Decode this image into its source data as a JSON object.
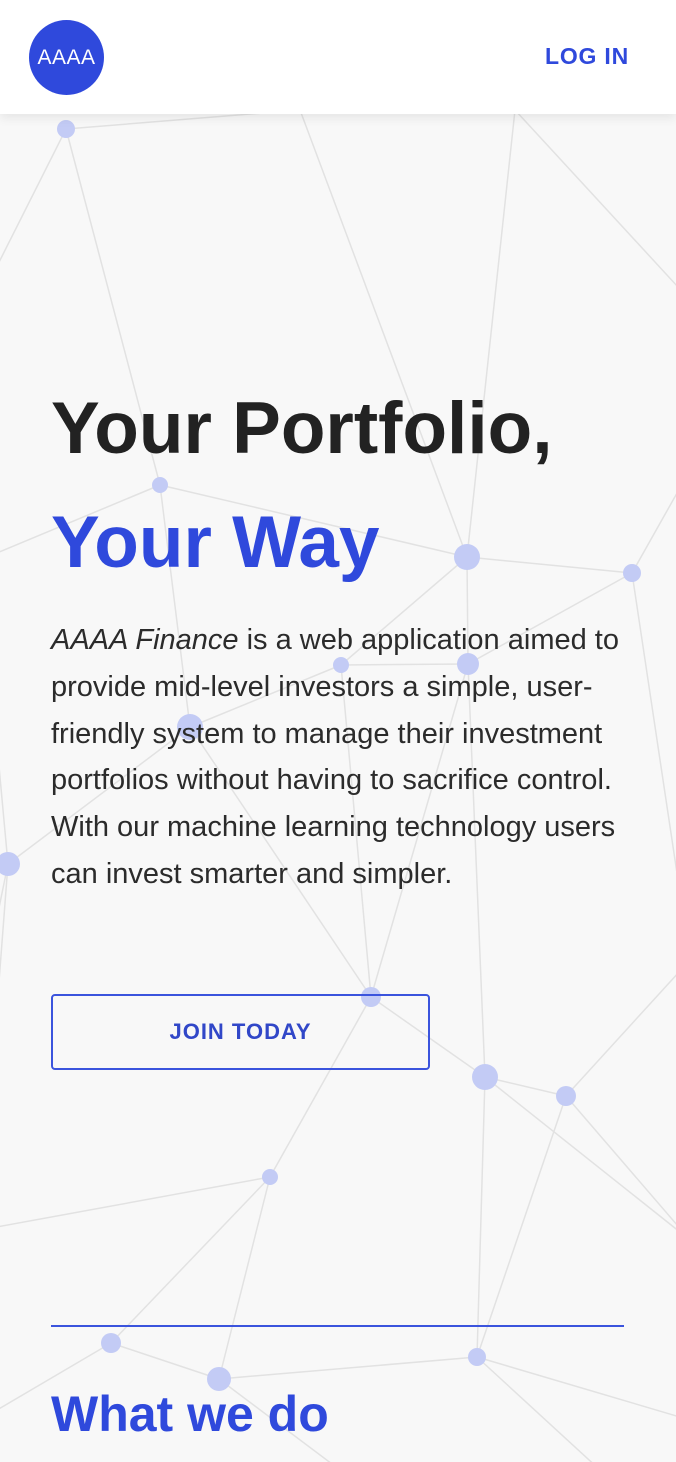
{
  "header": {
    "logo_text": "AAAA",
    "login_label": "LOG IN"
  },
  "hero": {
    "title_line1": "Your Portfolio,",
    "title_line2": "Your Way",
    "brand_name": "AAAA Finance",
    "description": " is a web application aimed to provide mid-level investors a simple, user-friendly system to manage their investment portfolios without having to sacrifice control. With our machine learning technology users can invest smarter and simpler.",
    "cta_label": "JOIN TODAY"
  },
  "section": {
    "title": "What we do"
  },
  "colors": {
    "accent": "#2f49dc",
    "background": "#f8f8f8",
    "text": "#222222",
    "node": "#c3cbf5",
    "line": "#e2e2e2"
  }
}
